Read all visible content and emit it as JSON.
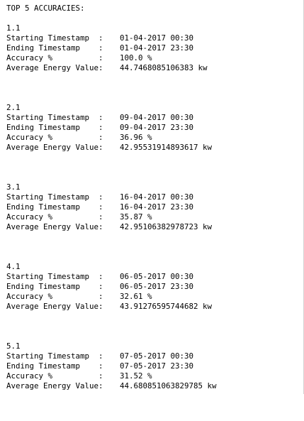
{
  "header": "TOP 5 ACCURACIES:",
  "labels": {
    "start": "Starting Timestamp  :",
    "end": "Ending Timestamp    :",
    "accuracy": "Accuracy %          :",
    "energy": "Average Energy Value:"
  },
  "entries": [
    {
      "id": "1.1",
      "start": "01-04-2017 00:30",
      "end": "01-04-2017 23:30",
      "accuracy": "100.0 %",
      "energy": "44.7468085106383 kw"
    },
    {
      "id": "2.1",
      "start": "09-04-2017 00:30",
      "end": "09-04-2017 23:30",
      "accuracy": "36.96 %",
      "energy": "42.95531914893617 kw"
    },
    {
      "id": "3.1",
      "start": "16-04-2017 00:30",
      "end": "16-04-2017 23:30",
      "accuracy": "35.87 %",
      "energy": "42.95106382978723 kw"
    },
    {
      "id": "4.1",
      "start": "06-05-2017 00:30",
      "end": "06-05-2017 23:30",
      "accuracy": "32.61 %",
      "energy": "43.91276595744682 kw"
    },
    {
      "id": "5.1",
      "start": "07-05-2017 00:30",
      "end": "07-05-2017 23:30",
      "accuracy": "31.52 %",
      "energy": "44.680851063829785 kw"
    }
  ]
}
